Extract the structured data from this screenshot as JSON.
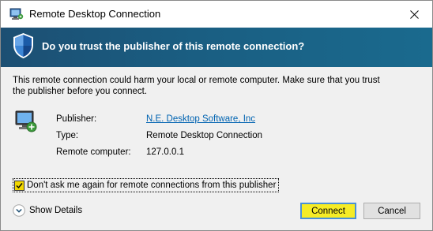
{
  "window": {
    "title": "Remote Desktop Connection",
    "close_glyph": "✕"
  },
  "banner": {
    "question": "Do you trust the publisher of this remote connection?"
  },
  "content": {
    "warning": "This remote connection could harm your local or remote computer. Make sure that you trust the publisher before you connect.",
    "fields": [
      {
        "label": "Publisher:",
        "value": "N.E. Desktop Software, Inc"
      },
      {
        "label": "Type:",
        "value": "Remote Desktop Connection"
      },
      {
        "label": "Remote computer:",
        "value": "127.0.0.1"
      }
    ],
    "checkbox": {
      "label": "Don't ask me again for remote connections from this publisher",
      "checked": true
    }
  },
  "footer": {
    "show_details": "Show Details",
    "connect": "Connect",
    "cancel": "Cancel"
  },
  "colors": {
    "banner": "#1c4f73",
    "link": "#0063b1",
    "highlight": "#f5ec26"
  },
  "icons": [
    "rdc-app-icon",
    "close-icon",
    "shield-icon",
    "remote-computer-icon",
    "check-icon",
    "chevron-down-icon"
  ]
}
